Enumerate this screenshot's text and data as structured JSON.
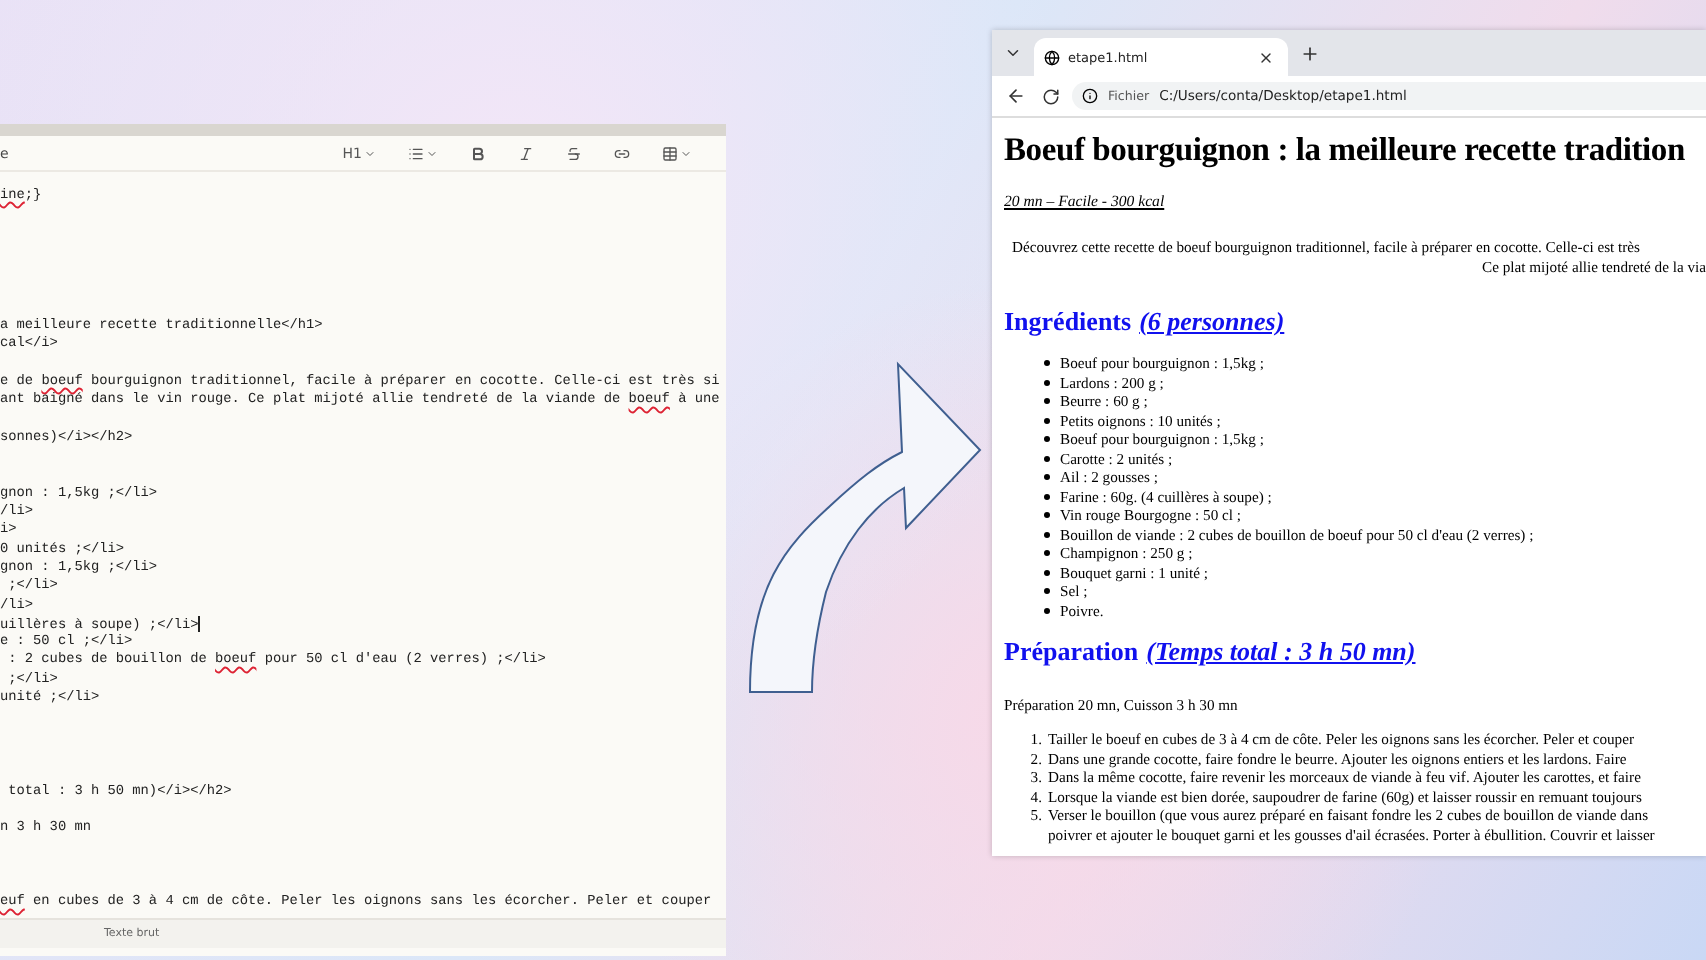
{
  "editor": {
    "toolbar": {
      "label": "e",
      "heading": "H1"
    },
    "code_blocks": [
      [
        {
          "parts": [
            {
              "text": "ine",
              "misspelled": true
            },
            {
              "text": ";}",
              "misspelled": false
            }
          ],
          "cursor": false
        }
      ],
      [
        {
          "text": "a meilleure recette traditionnelle</h1>",
          "cursor": false
        },
        {
          "text": "cal</i>",
          "cursor": false
        }
      ],
      [
        {
          "parts": [
            {
              "text": "e de ",
              "misspelled": false
            },
            {
              "text": "boeuf",
              "misspelled": true
            },
            {
              "text": " bourguignon traditionnel, facile à préparer en cocotte. Celle-ci est très si",
              "misspelled": false
            }
          ],
          "cursor": false
        },
        {
          "parts": [
            {
              "text": "ant baigné dans le vin rouge. Ce plat mijoté allie tendreté de la viande de ",
              "misspelled": false
            },
            {
              "text": "boeuf",
              "misspelled": true
            },
            {
              "text": " à une",
              "misspelled": false
            }
          ],
          "cursor": false
        }
      ],
      [
        {
          "text": "sonnes)</i></h2>",
          "cursor": false
        }
      ],
      [
        {
          "text": "gnon : 1,5kg ;</li>",
          "cursor": false
        },
        {
          "text": "/li>",
          "cursor": false
        },
        {
          "text": "i>",
          "cursor": false
        },
        {
          "text": "0 unités ;</li>",
          "cursor": false
        },
        {
          "text": "gnon : 1,5kg ;</li>",
          "cursor": false
        },
        {
          "text": " ;</li>",
          "cursor": false
        },
        {
          "text": "/li>",
          "cursor": false
        },
        {
          "text": "uillères à soupe) ;</li>",
          "cursor": true
        },
        {
          "text": "e : 50 cl ;</li>",
          "cursor": false
        },
        {
          "parts": [
            {
              "text": " : 2 cubes de bouillon de ",
              "misspelled": false
            },
            {
              "text": "boeuf",
              "misspelled": true
            },
            {
              "text": " pour 50 cl d'eau (2 verres) ;</li>",
              "misspelled": false
            }
          ],
          "cursor": false
        },
        {
          "text": " ;</li>",
          "cursor": false
        },
        {
          "text": "unité ;</li>",
          "cursor": false
        }
      ],
      [
        {
          "text": " total : 3 h 50 mn)</i></h2>",
          "cursor": false
        }
      ],
      [
        {
          "text": "n 3 h 30 mn",
          "cursor": false
        }
      ],
      [
        {
          "parts": [
            {
              "text": "euf",
              "misspelled": true
            },
            {
              "text": " en cubes de 3 à 4 cm de côte. Peler les oignons sans les écorcher. Peler et couper",
              "misspelled": false
            }
          ],
          "cursor": false
        }
      ]
    ],
    "status_bar": {
      "mode": "Texte brut"
    }
  },
  "browser": {
    "tab": {
      "title": "etape1.html"
    },
    "address": {
      "scheme": "Fichier",
      "url": "C:/Users/conta/Desktop/etape1.html"
    },
    "page": {
      "title": "Boeuf bourguignon : la meilleure recette tradition",
      "subtitle": "20 mn – Facile - 300 kcal",
      "intro_lines": [
        "Découvrez cette recette de boeuf bourguignon traditionnel, facile à préparer en cocotte. Celle-ci est très",
        "Ce plat mijoté allie tendreté de la via"
      ],
      "ingredients": {
        "heading": "Ingrédients",
        "link": "(6 personnes)",
        "items": [
          "Boeuf pour bourguignon : 1,5kg ;",
          "Lardons : 200 g ;",
          "Beurre : 60 g ;",
          "Petits oignons : 10 unités ;",
          "Boeuf pour bourguignon : 1,5kg ;",
          "Carotte : 2 unités ;",
          "Ail : 2 gousses ;",
          "Farine : 60g. (4 cuillères à soupe) ;",
          "Vin rouge Bourgogne : 50 cl ;",
          "Bouillon de viande : 2 cubes de bouillon de boeuf pour 50 cl d'eau (2 verres) ;",
          "Champignon : 250 g ;",
          "Bouquet garni : 1 unité ;",
          "Sel ;",
          "Poivre."
        ]
      },
      "preparation": {
        "heading": "Préparation",
        "link": "(Temps total : 3 h 50 mn)",
        "summary": "Préparation 20 mn, Cuisson 3 h 30 mn",
        "steps": [
          {
            "number": "1.",
            "lines": [
              "Tailler le boeuf en cubes de 3 à 4 cm de côte. Peler les oignons sans les écorcher. Peler et couper"
            ]
          },
          {
            "number": "2.",
            "lines": [
              "Dans une grande cocotte, faire fondre le beurre. Ajouter les oignons entiers et les lardons. Faire"
            ]
          },
          {
            "number": "3.",
            "lines": [
              "Dans la même cocotte, faire revenir les morceaux de viande à feu vif. Ajouter les carottes, et faire"
            ]
          },
          {
            "number": "4.",
            "lines": [
              "Lorsque la viande est bien dorée, saupoudrer de farine (60g) et laisser roussir en remuant toujours"
            ]
          },
          {
            "number": "5.",
            "lines": [
              "Verser le bouillon (que vous aurez préparé en faisant fondre les 2 cubes de bouillon de viande dans",
              "poivrer et ajouter le bouquet garni et les gousses d'ail écrasées. Porter à ébullition. Couvrir et laisser"
            ]
          }
        ]
      }
    }
  }
}
